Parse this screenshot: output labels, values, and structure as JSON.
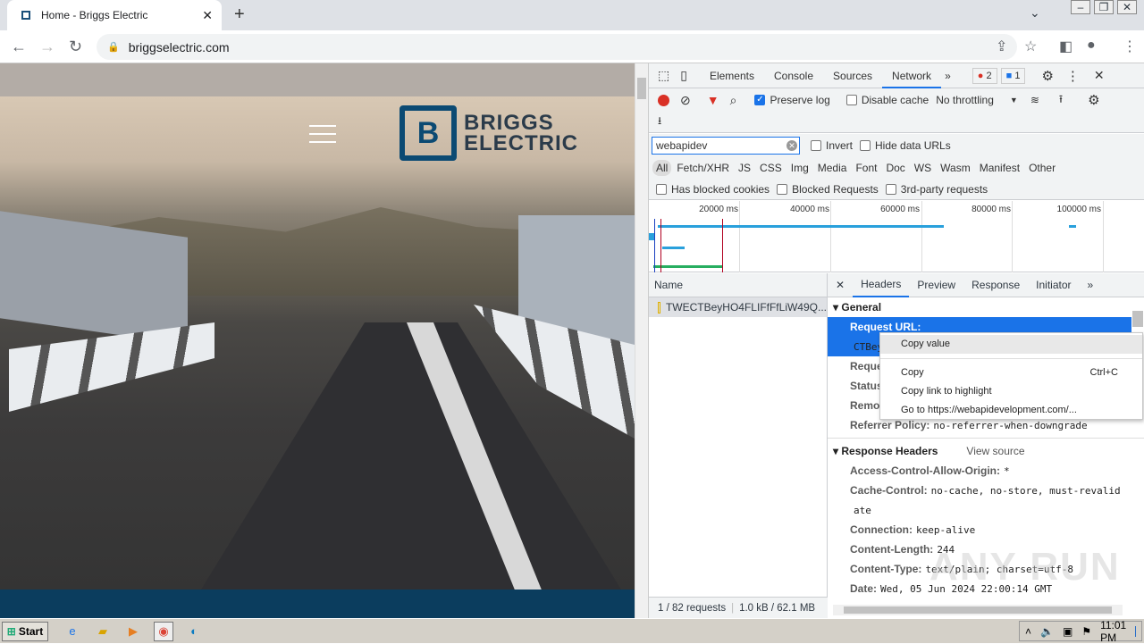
{
  "browser": {
    "tab_title": "Home - Briggs Electric",
    "url": "briggselectric.com"
  },
  "site": {
    "logo_line1": "BRIGGS",
    "logo_line2": "ELECTRIC",
    "logo_mark": "B"
  },
  "devtools": {
    "tabs": [
      "Elements",
      "Console",
      "Sources",
      "Network"
    ],
    "active_tab": "Network",
    "error_count": "2",
    "message_count": "1",
    "preserve_log": "Preserve log",
    "disable_cache": "Disable cache",
    "throttling": "No throttling",
    "filter_value": "webapidev",
    "invert": "Invert",
    "hide_data_urls": "Hide data URLs",
    "types": [
      "All",
      "Fetch/XHR",
      "JS",
      "CSS",
      "Img",
      "Media",
      "Font",
      "Doc",
      "WS",
      "Wasm",
      "Manifest",
      "Other"
    ],
    "has_blocked_cookies": "Has blocked cookies",
    "blocked_requests": "Blocked Requests",
    "third_party": "3rd-party requests",
    "timeline_ticks": [
      "20000 ms",
      "40000 ms",
      "60000 ms",
      "80000 ms",
      "100000 ms"
    ],
    "name_header": "Name",
    "request_name": "TWECTBeyHO4FLIFfFfLiW49Q...",
    "status_bar": {
      "requests": "1 / 82 requests",
      "size": "1.0 kB / 62.1 MB"
    },
    "detail_tabs": [
      "Headers",
      "Preview",
      "Response",
      "Initiator"
    ],
    "general": {
      "title": "General",
      "rows": [
        {
          "k": "Request URL:",
          "v": ""
        },
        {
          "k": "",
          "v": "CTBey"
        },
        {
          "k": "Request Method:",
          "v": ""
        },
        {
          "k": "Status Code:",
          "v": ""
        },
        {
          "k": "Remote Address:",
          "v": ""
        },
        {
          "k": "Referrer Policy:",
          "v": "no-referrer-when-downgrade"
        }
      ]
    },
    "response_headers": {
      "title": "Response Headers",
      "view_source": "View source",
      "rows": [
        {
          "k": "Access-Control-Allow-Origin:",
          "v": "*"
        },
        {
          "k": "Cache-Control:",
          "v": "no-cache, no-store, must-revalid"
        },
        {
          "k": "",
          "v": "ate"
        },
        {
          "k": "Connection:",
          "v": "keep-alive"
        },
        {
          "k": "Content-Length:",
          "v": "244"
        },
        {
          "k": "Content-Type:",
          "v": "text/plain; charset=utf-8"
        },
        {
          "k": "Date:",
          "v": "Wed, 05 Jun 2024 22:00:14 GMT"
        }
      ]
    },
    "context_menu": {
      "copy_value": "Copy value",
      "copy": "Copy",
      "copy_shortcut": "Ctrl+C",
      "copy_link": "Copy link to highlight",
      "goto": "Go to https://webapidevelopment.com/..."
    }
  },
  "watermark": "ANY RUN",
  "taskbar": {
    "start": "Start",
    "clock": "11:01 PM"
  }
}
